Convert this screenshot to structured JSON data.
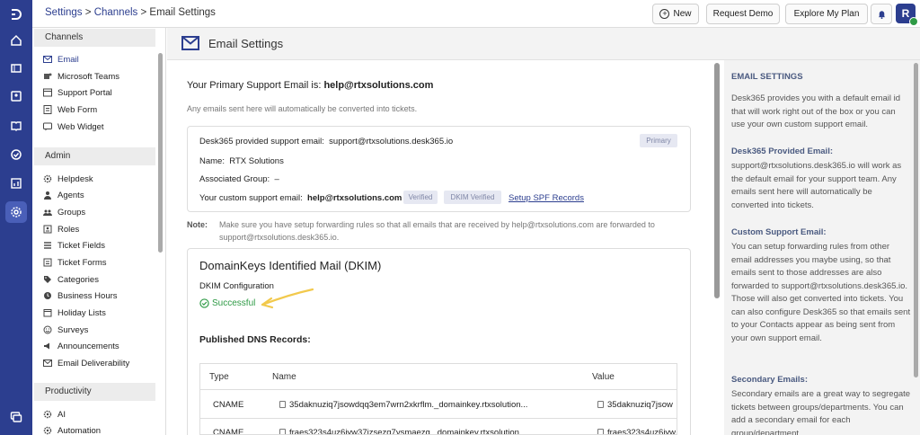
{
  "breadcrumb": {
    "settings": "Settings",
    "sep": ">",
    "channels": "Channels",
    "current": "Email Settings"
  },
  "topbar": {
    "new_label": "New",
    "demo_label": "Request Demo",
    "plan_label": "Explore My Plan",
    "avatar_initial": "R"
  },
  "sidebar": {
    "channels_title": "Channels",
    "channels": [
      {
        "label": "Email",
        "icon": "mail-icon"
      },
      {
        "label": "Microsoft Teams",
        "icon": "teams-icon"
      },
      {
        "label": "Support Portal",
        "icon": "portal-icon"
      },
      {
        "label": "Web Form",
        "icon": "form-icon"
      },
      {
        "label": "Web Widget",
        "icon": "widget-icon"
      }
    ],
    "admin_title": "Admin",
    "admin": [
      {
        "label": "Helpdesk",
        "icon": "gear-icon"
      },
      {
        "label": "Agents",
        "icon": "user-icon"
      },
      {
        "label": "Groups",
        "icon": "group-icon"
      },
      {
        "label": "Roles",
        "icon": "roles-icon"
      },
      {
        "label": "Ticket Fields",
        "icon": "fields-icon"
      },
      {
        "label": "Ticket Forms",
        "icon": "forms-icon"
      },
      {
        "label": "Categories",
        "icon": "tag-icon"
      },
      {
        "label": "Business Hours",
        "icon": "clock-icon"
      },
      {
        "label": "Holiday Lists",
        "icon": "calendar-icon"
      },
      {
        "label": "Surveys",
        "icon": "survey-icon"
      },
      {
        "label": "Announcements",
        "icon": "announce-icon"
      },
      {
        "label": "Email Deliverability",
        "icon": "mail-icon"
      }
    ],
    "productivity_title": "Productivity",
    "productivity": [
      {
        "label": "AI",
        "icon": "gear-icon"
      },
      {
        "label": "Automation",
        "icon": "gear-icon"
      }
    ]
  },
  "page": {
    "title": "Email Settings",
    "primary_prefix": "Your Primary Support Email is:",
    "primary_email": "help@rtxsolutions.com",
    "auto_note": "Any emails sent here will automatically be converted into tickets.",
    "provided_label": "Desk365 provided support email:",
    "provided_email": "support@rtxsolutions.desk365.io",
    "primary_badge": "Primary",
    "name_label": "Name:",
    "name_value": "RTX Solutions",
    "group_label": "Associated Group:",
    "group_value": "–",
    "custom_label": "Your custom support email:",
    "custom_email": "help@rtxsolutions.com",
    "verified_badge": "Verified",
    "dkim_badge": "DKIM Verified",
    "spf_link": "Setup SPF Records",
    "note_label": "Note:",
    "note_line1": "Make sure you have setup forwarding rules so that all emails that are received by help@rtxsolutions.com are forwarded to",
    "note_line2": "support@rtxsolutions.desk365.io.",
    "dkim_title": "DomainKeys Identified Mail (DKIM)",
    "dkim_config": "DKIM Configuration",
    "dkim_status": "Successful",
    "dns_title": "Published DNS Records:",
    "table": {
      "headers": [
        "Type",
        "Name",
        "Value"
      ],
      "rows": [
        {
          "type": "CNAME",
          "name": "35daknuziq7jsowdqq3em7wrn2xkrflm._domainkey.rtxsolution...",
          "value": "35daknuziq7jsow"
        },
        {
          "type": "CNAME",
          "name": "fraes323s4uz6iyw37izsezg7ysmaezg._domainkey.rtxsolution...",
          "value": "fraes323s4uz6iyw"
        }
      ]
    }
  },
  "right_panel": {
    "title": "EMAIL SETTINGS",
    "intro": "Desk365 provides you with a default email id that will work right out of the box or you can use your own custom support email.",
    "provided_heading": "Desk365 Provided Email:",
    "provided_text": "support@rtxsolutions.desk365.io will work as the default email for your support team. Any emails sent here will automatically be converted into tickets.",
    "custom_heading": "Custom Support Email:",
    "custom_text": "You can setup forwarding rules from other email addresses you maybe using, so that emails sent to those addresses are also forwarded to support@rtxsolutions.desk365.io. Those will also get converted into tickets. You can also configure Desk365 so that emails sent to your Contacts appear as being sent from your own support email.",
    "secondary_heading": "Secondary Emails:",
    "secondary_text": "Secondary emails are a great way to segregate tickets between groups/departments. You can add a secondary email for each group/department"
  },
  "colors": {
    "brand": "#2c3e8f",
    "success": "#2e9a45",
    "annotation_arrow": "#f2c94c"
  }
}
